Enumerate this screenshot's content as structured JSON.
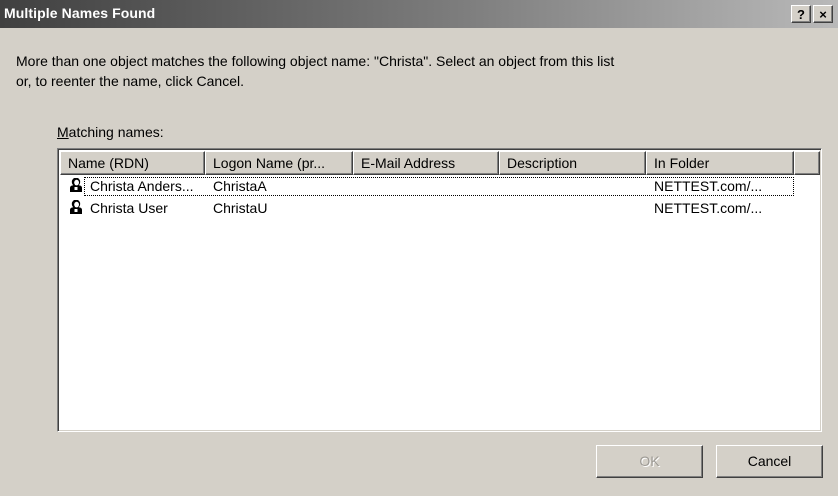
{
  "window": {
    "title": "Multiple Names Found",
    "help_glyph": "?",
    "close_glyph": "×"
  },
  "message": "More than one object matches the following object name: \"Christa\". Select an object from this list or, to reenter the name, click Cancel.",
  "matching_label": {
    "accel": "M",
    "rest": "atching names:"
  },
  "list": {
    "columns": [
      "Name (RDN)",
      "Logon Name (pr...",
      "E-Mail Address",
      "Description",
      "In Folder"
    ],
    "rows": [
      {
        "icon": "user-icon",
        "name": "Christa Anders...",
        "logon": "ChristaA",
        "email": "",
        "description": "",
        "folder": "NETTEST.com/..."
      },
      {
        "icon": "user-icon",
        "name": "Christa User",
        "logon": "ChristaU",
        "email": "",
        "description": "",
        "folder": "NETTEST.com/..."
      }
    ]
  },
  "buttons": {
    "ok": "OK",
    "cancel": "Cancel"
  }
}
